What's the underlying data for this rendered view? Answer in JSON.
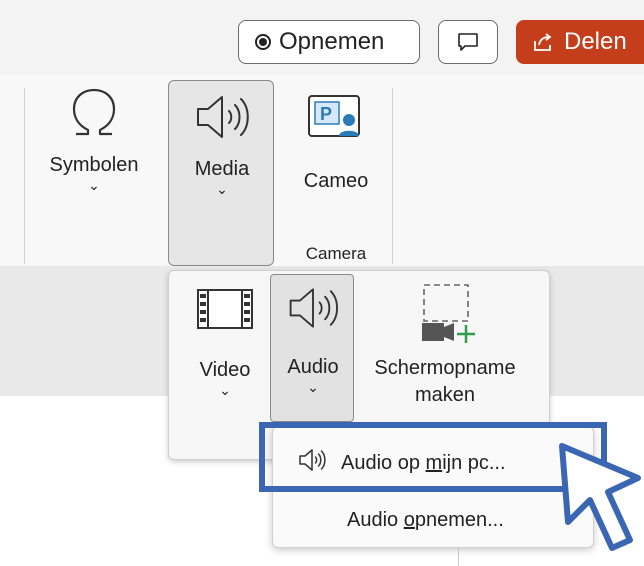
{
  "titlebar": {
    "record_label": "Opnemen",
    "share_label": "Delen"
  },
  "ribbon": {
    "symbols_label": "Symbolen",
    "media_label": "Media",
    "cameo_label": "Cameo",
    "camera_group_label": "Camera"
  },
  "media_menu": {
    "video_label": "Video",
    "audio_label": "Audio",
    "screen_recording_line1": "Schermopname",
    "screen_recording_line2": "maken"
  },
  "audio_menu": {
    "items": [
      {
        "label_pre": "Audio op ",
        "label_key": "m",
        "label_post": "ijn pc..."
      },
      {
        "label_pre": "Audio ",
        "label_key": "o",
        "label_post": "pnemen..."
      }
    ]
  },
  "colors": {
    "share_button": "#c43e1c",
    "highlight_border": "#3b66b4",
    "cameo_icon": "#2b7bb9",
    "add_plus": "#2e9e48"
  },
  "icons": [
    "record-icon",
    "comment-icon",
    "share-icon",
    "omega-icon",
    "speaker-icon",
    "cameo-icon",
    "film-icon",
    "screen-recording-icon",
    "cursor-icon"
  ]
}
